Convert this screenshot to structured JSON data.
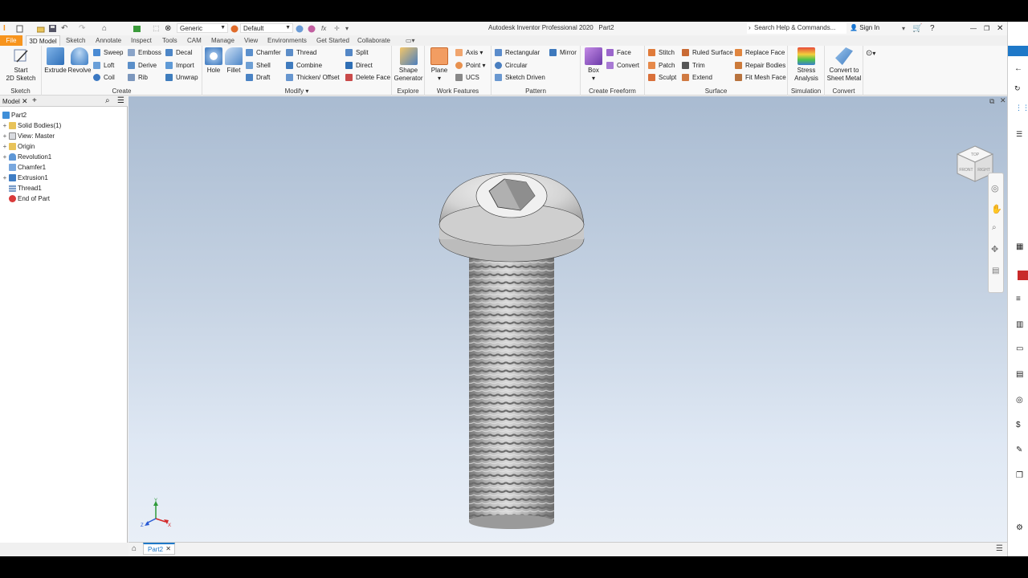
{
  "app": {
    "title": "Autodesk Inventor Professional 2020",
    "document": "Part2"
  },
  "quick_access": {
    "appearance_combo": "Generic",
    "material_combo": "Default",
    "fx": "fx"
  },
  "help": {
    "search_placeholder": "Search Help & Commands...",
    "sign_in": "Sign In"
  },
  "tabs": [
    "File",
    "3D Model",
    "Sketch",
    "Annotate",
    "Inspect",
    "Tools",
    "CAM",
    "Manage",
    "View",
    "Environments",
    "Get Started",
    "Collaborate"
  ],
  "ribbon": {
    "sketch_panel": {
      "label": "Sketch",
      "start_sketch_line1": "Start",
      "start_sketch_line2": "2D Sketch"
    },
    "create_panel": {
      "label": "Create",
      "extrude": "Extrude",
      "revolve": "Revolve",
      "sweep": "Sweep",
      "loft": "Loft",
      "coil": "Coil",
      "emboss": "Emboss",
      "derive": "Derive",
      "rib": "Rib",
      "decal": "Decal",
      "import": "Import",
      "unwrap": "Unwrap"
    },
    "modify_panel": {
      "label": "Modify",
      "hole": "Hole",
      "fillet": "Fillet",
      "chamfer": "Chamfer",
      "shell": "Shell",
      "draft": "Draft",
      "thread": "Thread",
      "combine": "Combine",
      "thicken": "Thicken/ Offset",
      "split": "Split",
      "direct": "Direct",
      "delete_face": "Delete Face"
    },
    "explore_panel": {
      "label": "Explore",
      "shape_gen_line1": "Shape",
      "shape_gen_line2": "Generator"
    },
    "work_features_panel": {
      "label": "Work Features",
      "plane": "Plane",
      "axis": "Axis",
      "point": "Point",
      "ucs": "UCS"
    },
    "pattern_panel": {
      "label": "Pattern",
      "rectangular": "Rectangular",
      "circular": "Circular",
      "sketch_driven": "Sketch Driven",
      "mirror": "Mirror"
    },
    "freeform_panel": {
      "label": "Create Freeform",
      "box": "Box",
      "face": "Face",
      "convert": "Convert"
    },
    "surface_panel": {
      "label": "Surface",
      "stitch": "Stitch",
      "patch": "Patch",
      "sculpt": "Sculpt",
      "ruled_surface": "Ruled Surface",
      "trim": "Trim",
      "extend": "Extend",
      "replace_face": "Replace Face",
      "repair_bodies": "Repair Bodies",
      "fit_mesh_face": "Fit Mesh Face"
    },
    "simulation_panel": {
      "label": "Simulation",
      "stress_line1": "Stress",
      "stress_line2": "Analysis"
    },
    "convert_panel": {
      "label": "Convert",
      "sheet_line1": "Convert to",
      "sheet_line2": "Sheet Metal"
    }
  },
  "browser": {
    "tab_label": "Model",
    "nodes": [
      {
        "label": "Part2",
        "expander": ""
      },
      {
        "label": "Solid Bodies(1)",
        "expander": "+"
      },
      {
        "label": "View: Master",
        "expander": "+"
      },
      {
        "label": "Origin",
        "expander": "+"
      },
      {
        "label": "Revolution1",
        "expander": "+"
      },
      {
        "label": "Chamfer1",
        "expander": ""
      },
      {
        "label": "Extrusion1",
        "expander": "+"
      },
      {
        "label": "Thread1",
        "expander": ""
      },
      {
        "label": "End of Part",
        "expander": ""
      }
    ]
  },
  "viewcube": {
    "top": "TOP",
    "front": "FRONT",
    "right": "RIGHT"
  },
  "triad": {
    "x": "X",
    "y": "Y",
    "z": "Z"
  },
  "doc_tabs": {
    "active": "Part2"
  },
  "colors": {
    "file_tab": "#f7941d",
    "accent_blue": "#1e78c8",
    "viewport_top": "#a9bbd1",
    "viewport_bottom": "#e9eff7"
  }
}
